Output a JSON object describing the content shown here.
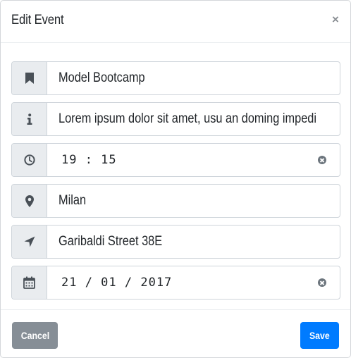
{
  "modal": {
    "title": "Edit Event",
    "close_symbol": "×"
  },
  "fields": {
    "name": {
      "icon": "bookmark-icon",
      "value": "Model Bootcamp"
    },
    "description": {
      "icon": "info-icon",
      "value": "Lorem ipsum dolor sit amet, usu an doming impedi"
    },
    "time": {
      "icon": "clock-icon",
      "value": "19 : 15"
    },
    "city": {
      "icon": "map-marker-icon",
      "value": "Milan"
    },
    "address": {
      "icon": "location-arrow-icon",
      "value": "Garibaldi Street 38E"
    },
    "date": {
      "icon": "calendar-icon",
      "value": "21 / 01 / 2017"
    }
  },
  "footer": {
    "cancel_label": "Cancel",
    "save_label": "Save"
  },
  "colors": {
    "primary": "#007bff",
    "secondary": "#868e96",
    "addon_bg": "#e9ecef",
    "border": "#ced4da",
    "icon": "#495057"
  }
}
